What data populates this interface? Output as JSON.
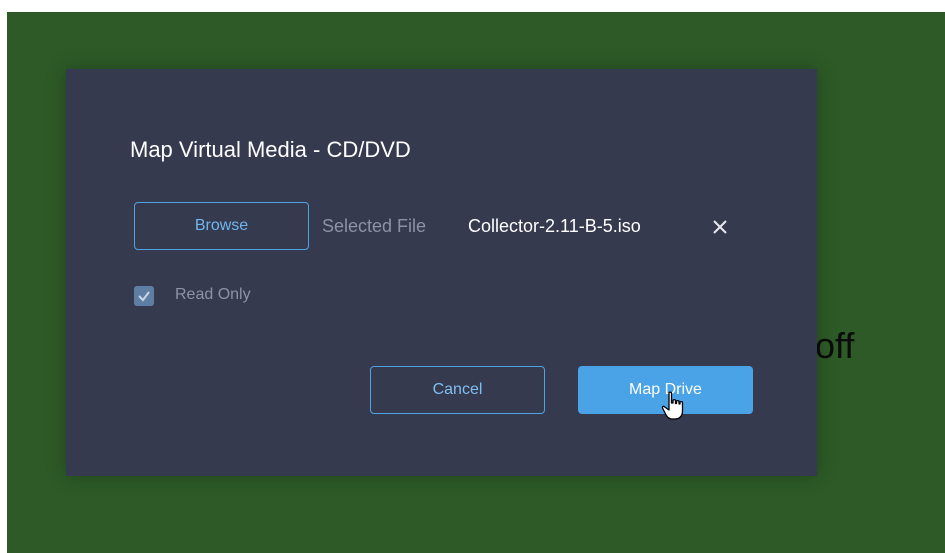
{
  "background": {
    "partial_text": "off",
    "colors": {
      "backdrop": "#2d5a27",
      "dialog": "#363a4f",
      "accent": "#4aa3e6"
    }
  },
  "dialog": {
    "title": "Map Virtual Media - CD/DVD",
    "browse_label": "Browse",
    "selected_file_label": "Selected File",
    "selected_file_value": "Collector-2.11-B-5.iso",
    "clear_icon": "close-icon",
    "read_only": {
      "label": "Read Only",
      "checked": true,
      "disabled": true
    },
    "cancel_label": "Cancel",
    "map_drive_label": "Map Drive"
  },
  "pointer": "hand-cursor-icon"
}
